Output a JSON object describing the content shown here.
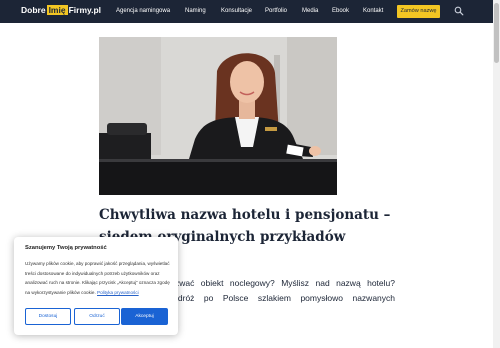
{
  "header": {
    "logo": {
      "part1": "Dobre",
      "part2": "Imię",
      "part3": "Firmy.pl"
    },
    "nav": [
      "Agencja namingowa",
      "Naming",
      "Konsultacje",
      "Portfolio",
      "Media",
      "Ebook",
      "Kontakt"
    ],
    "cta_label": "Zamów nazwę",
    "search_icon": "search-icon"
  },
  "colors": {
    "header_bg": "#1c2536",
    "accent_yellow": "#f3c623",
    "title_color": "#1c2536",
    "cookie_blue": "#1a63d4"
  },
  "article": {
    "hero_image": "receptionist-hotel-desk",
    "title": "Chwytliwa nazwa hotelu i pensjonatu – siedem oryginalnych przykładów",
    "intro": "Nie wiesz, jak nazwać obiekt noclegowy? Myślisz nad nazwą hotelu? Wyruszamy w podróż po Polsce szlakiem pomysłowo nazwanych apartamentów."
  },
  "cookie": {
    "title": "Szanujemy Twoją prywatność",
    "text": "Używamy plików cookie, aby poprawić jakość przeglądania, wyświetlać treści dostosowane do indywidualnych potrzeb użytkowników oraz analizować ruch na stronie. Klikając przycisk „Akceptuj” oznacza zgodę na wykorzystywanie plików cookie.",
    "link_label": "Polityka prywatności",
    "buttons": {
      "customize": "Dostosuj",
      "reject": "Odrzuć",
      "accept": "Akceptuj"
    }
  }
}
